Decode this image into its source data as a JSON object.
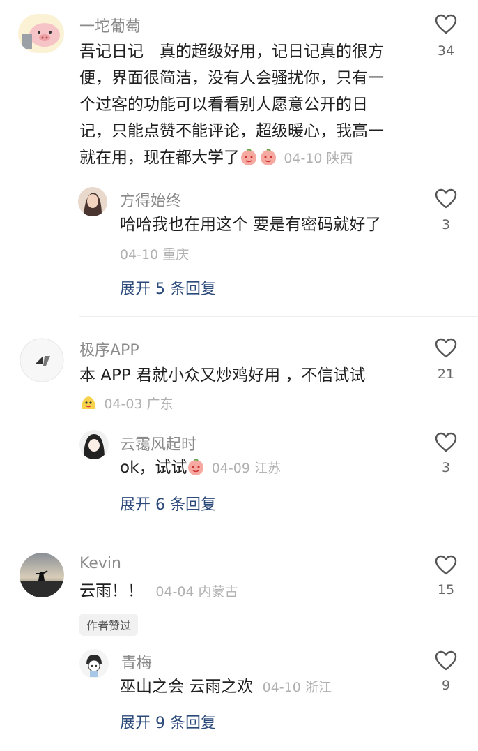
{
  "comments": [
    {
      "user": "一坨葡萄",
      "text_lines": [
        "吾记日记　真的超级好用，记日记真的很方",
        "便，界面很简洁，没有人会骚扰你，只有一",
        "个过客的功能可以看看别人愿意公开的日",
        "记，只能点赞不能评论，超级暖心，我高一"
      ],
      "last_line": "就在用，现在都大学了",
      "meta": "04-10 陕西",
      "likes": "34",
      "reply": {
        "user": "方得始终",
        "text": "哈哈我也在用这个 要是有密码就好了",
        "meta": "04-10 重庆",
        "likes": "3"
      },
      "expand": "展开 5 条回复"
    },
    {
      "user": "极序APP",
      "text": "本 APP 君就小众又炒鸡好用 ，不信试试",
      "meta": "04-03 广东",
      "likes": "21",
      "reply": {
        "user": "云霭风起时",
        "text": "ok，试试",
        "meta": "04-09 江苏",
        "likes": "3"
      },
      "expand": "展开 6 条回复"
    },
    {
      "user": "Kevin",
      "text": "云雨！！",
      "meta": "04-04 内蒙古",
      "likes": "15",
      "badge": "作者赞过",
      "reply": {
        "user": "青梅",
        "text": "巫山之会 云雨之欢",
        "meta": "04-10 浙江",
        "likes": "9"
      },
      "expand": "展开 9 条回复"
    }
  ],
  "icons": {
    "like": "heart-outline-icon",
    "emoji": "peach-emoji-icon"
  },
  "colors": {
    "link": "#2b4a7a",
    "meta": "#b0b0b0",
    "username": "#8a8a8a"
  }
}
